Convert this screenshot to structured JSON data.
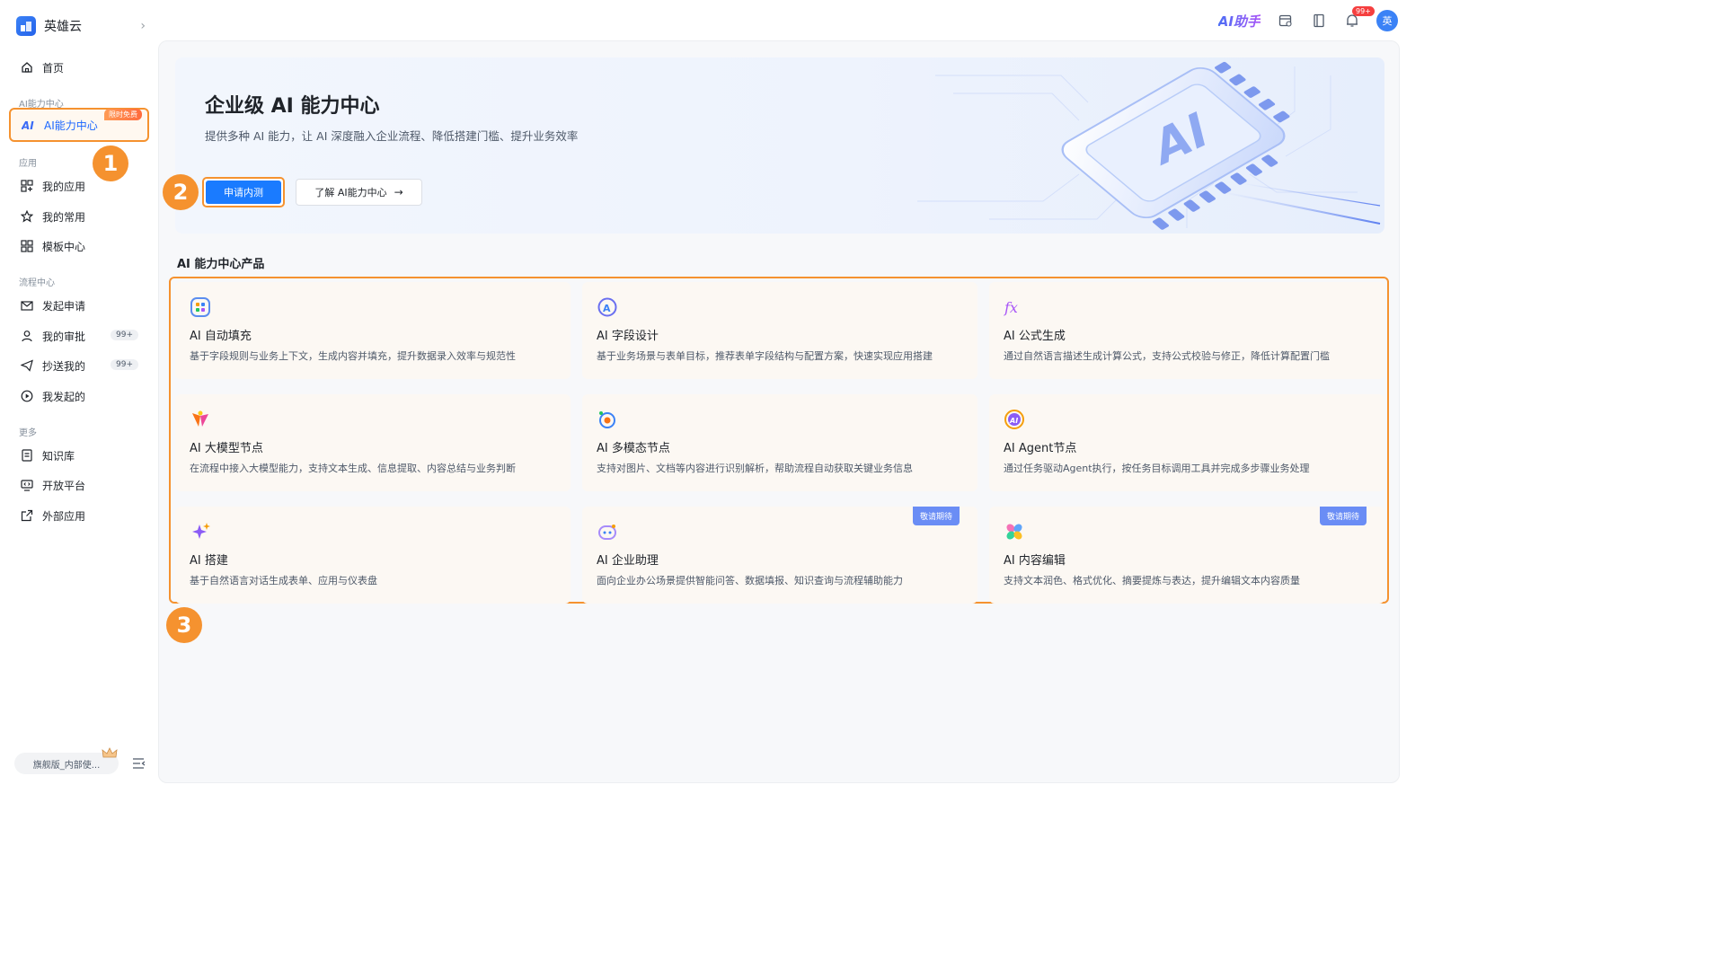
{
  "brand": {
    "name": "英雄云"
  },
  "sidebar": {
    "home": "首页",
    "group_ai": "AI能力中心",
    "ai_center": {
      "label": "AI能力中心",
      "badge": "限时免费"
    },
    "group_apps": "应用",
    "my_apps": "我的应用",
    "my_frequent": "我的常用",
    "templates": "模板中心",
    "group_flow": "流程中心",
    "start_request": "发起申请",
    "my_approvals": {
      "label": "我的审批",
      "count": "99+"
    },
    "cc_me": {
      "label": "抄送我的",
      "count": "99+"
    },
    "my_started": "我发起的",
    "group_more": "更多",
    "knowledge": "知识库",
    "open_platform": "开放平台",
    "external_apps": "外部应用",
    "edition": "旗舰版_内部使..."
  },
  "topbar": {
    "ai_helper": "AI助手",
    "notification_count": "99+",
    "avatar": "英"
  },
  "markers": [
    "1",
    "2",
    "3"
  ],
  "hero": {
    "title": "企业级 AI 能力中心",
    "subtitle": "提供多种 AI 能力，让 AI 深度融入企业流程、降低搭建门槛、提升业务效率",
    "primary_button": "申请内测",
    "secondary_button": "了解 AI能力中心",
    "chip_label": "AI"
  },
  "products": {
    "title": "AI 能力中心产品",
    "items": [
      {
        "title": "AI 自动填充",
        "desc": "基于字段规则与业务上下文，生成内容并填充，提升数据录入效率与规范性",
        "icon": "grid-icon"
      },
      {
        "title": "AI 字段设计",
        "desc": "基于业务场景与表单目标，推荐表单字段结构与配置方案，快速实现应用搭建",
        "icon": "field-design-icon"
      },
      {
        "title": "AI 公式生成",
        "desc": "通过自然语言描述生成计算公式，支持公式校验与修正，降低计算配置门槛",
        "icon": "fx-icon"
      },
      {
        "title": "AI 大模型节点",
        "desc": "在流程中接入大模型能力，支持文本生成、信息提取、内容总结与业务判断",
        "icon": "llm-node-icon"
      },
      {
        "title": "AI 多模态节点",
        "desc": "支持对图片、文档等内容进行识别解析，帮助流程自动获取关键业务信息",
        "icon": "multimodal-icon"
      },
      {
        "title": "AI Agent节点",
        "desc": "通过任务驱动Agent执行，按任务目标调用工具并完成多步骤业务处理",
        "icon": "agent-icon"
      },
      {
        "title": "AI 搭建",
        "desc": "基于自然语言对话生成表单、应用与仪表盘",
        "icon": "sparkle-icon"
      },
      {
        "title": "AI 企业助理",
        "desc": "面向企业办公场景提供智能问答、数据填报、知识查询与流程辅助能力",
        "icon": "assistant-icon",
        "badge": "敬请期待"
      },
      {
        "title": "AI 内容编辑",
        "desc": "支持文本润色、格式优化、摘要提炼与表达，提升编辑文本内容质量",
        "icon": "content-edit-icon",
        "badge": "敬请期待"
      }
    ]
  }
}
